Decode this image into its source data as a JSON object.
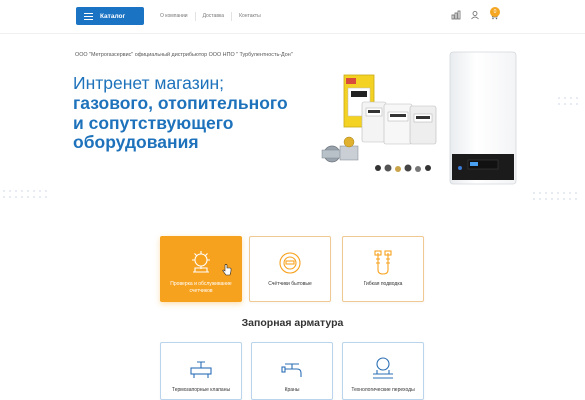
{
  "header": {
    "catalog_label": "Каталог",
    "nav": [
      "О компании",
      "Доставка",
      "Контакты"
    ],
    "cart_count": "0"
  },
  "hero": {
    "subtitle": "ООО \"Метрогазсервис\" официальный дистрибьютор ООО НПО \" Турбулентность-Дон\"",
    "title_line1": "Интренет магазин;",
    "title_line2": "газового, отопительного",
    "title_line3": "и сопутствующего",
    "title_line4": "оборудования"
  },
  "categories": [
    {
      "label": "Проверка и обслуживание счетчиков",
      "icon": "service-icon"
    },
    {
      "label": "Счётчики бытовые",
      "icon": "meter-icon"
    },
    {
      "label": "Гибкая подводка",
      "icon": "hose-icon"
    }
  ],
  "section2": {
    "title": "Запорная арматура",
    "items": [
      {
        "label": "Термозапорные клапаны",
        "icon": "valve-icon"
      },
      {
        "label": "Краны",
        "icon": "tap-icon"
      },
      {
        "label": "Технологические переходы",
        "icon": "pipe-icon"
      }
    ]
  },
  "colors": {
    "brand_blue": "#1b73c4",
    "accent_orange": "#f7a21f"
  }
}
